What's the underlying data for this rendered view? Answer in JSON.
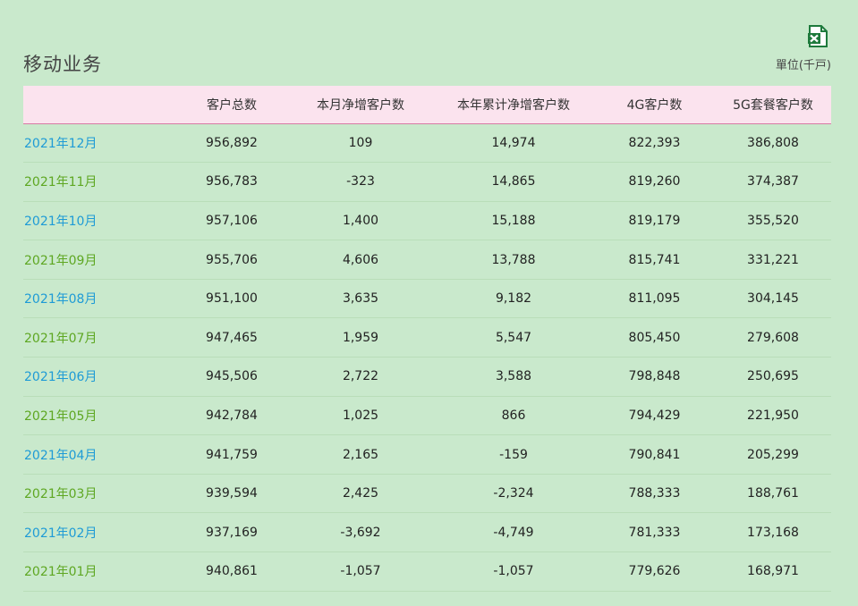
{
  "title": "移动业务",
  "unit": "單位(千戸)",
  "icons": {
    "export": "excel-export-icon"
  },
  "colors": {
    "background": "#c9e9cc",
    "header_bg": "#fbe3ee",
    "header_border": "#d77ba4",
    "month_blue": "#1e9bd6",
    "month_green": "#5ea722",
    "excel_green": "#1e7a3c"
  },
  "table": {
    "headers": [
      "",
      "客户总数",
      "本月净增客户数",
      "本年累计净增客户数",
      "4G客户数",
      "5G套餐客户数"
    ],
    "rows": [
      [
        "2021年12月",
        "956,892",
        "109",
        "14,974",
        "822,393",
        "386,808"
      ],
      [
        "2021年11月",
        "956,783",
        "-323",
        "14,865",
        "819,260",
        "374,387"
      ],
      [
        "2021年10月",
        "957,106",
        "1,400",
        "15,188",
        "819,179",
        "355,520"
      ],
      [
        "2021年09月",
        "955,706",
        "4,606",
        "13,788",
        "815,741",
        "331,221"
      ],
      [
        "2021年08月",
        "951,100",
        "3,635",
        "9,182",
        "811,095",
        "304,145"
      ],
      [
        "2021年07月",
        "947,465",
        "1,959",
        "5,547",
        "805,450",
        "279,608"
      ],
      [
        "2021年06月",
        "945,506",
        "2,722",
        "3,588",
        "798,848",
        "250,695"
      ],
      [
        "2021年05月",
        "942,784",
        "1,025",
        "866",
        "794,429",
        "221,950"
      ],
      [
        "2021年04月",
        "941,759",
        "2,165",
        "-159",
        "790,841",
        "205,299"
      ],
      [
        "2021年03月",
        "939,594",
        "2,425",
        "-2,324",
        "788,333",
        "188,761"
      ],
      [
        "2021年02月",
        "937,169",
        "-3,692",
        "-4,749",
        "781,333",
        "173,168"
      ],
      [
        "2021年01月",
        "940,861",
        "-1,057",
        "-1,057",
        "779,626",
        "168,971"
      ]
    ]
  }
}
